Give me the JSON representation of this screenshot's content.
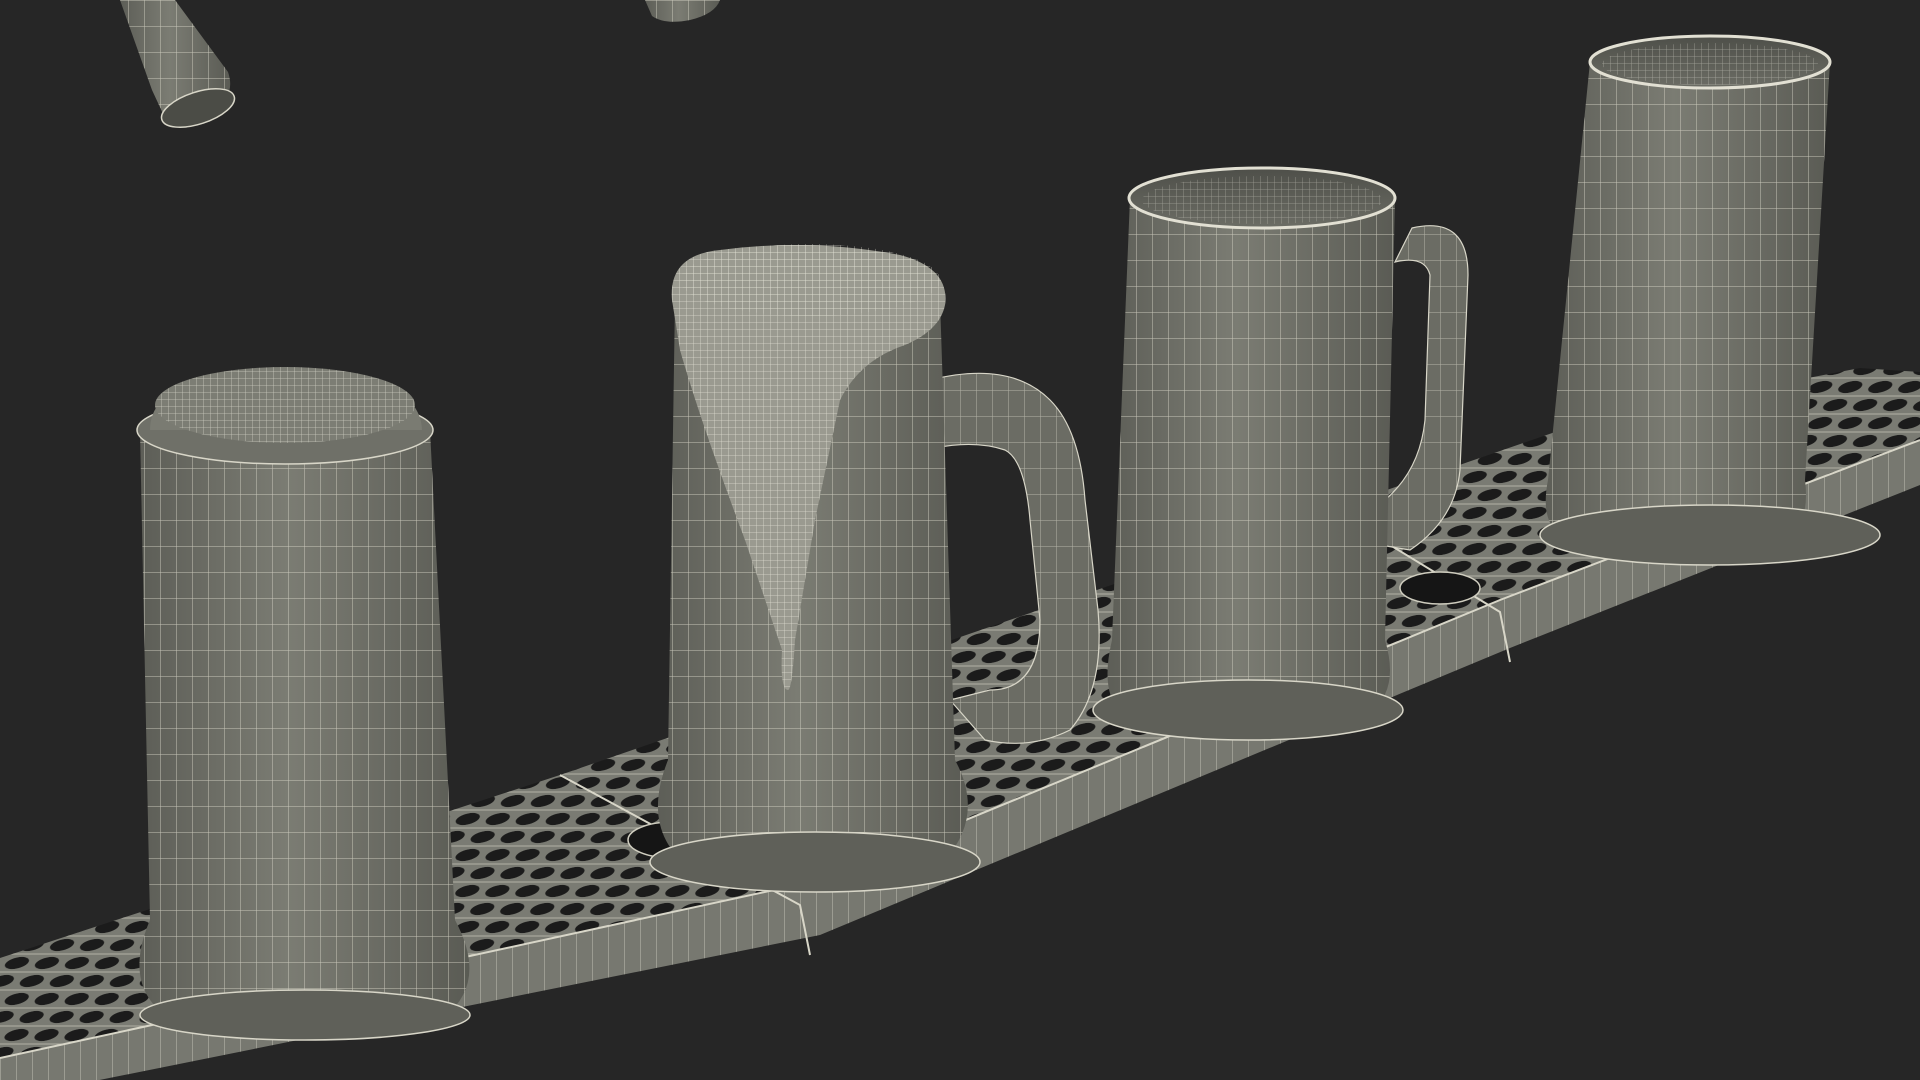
{
  "scene": {
    "background": "#262626",
    "mesh_fill": "#6f7068",
    "mesh_fill_dark": "#55564f",
    "mesh_fill_light": "#86877e",
    "wire_color": "#d8d6c8",
    "hole_color": "#1b1b1b",
    "objects": [
      {
        "name": "beer-tap-nozzle-left",
        "kind": "tap"
      },
      {
        "name": "beer-tap-nozzle-right",
        "kind": "tap"
      },
      {
        "name": "drip-tray",
        "kind": "tray",
        "segments": 3
      },
      {
        "name": "mug-lidded",
        "kind": "mug",
        "state": "lidded"
      },
      {
        "name": "mug-foaming",
        "kind": "mug",
        "state": "overflowing foam"
      },
      {
        "name": "mug-empty",
        "kind": "mug",
        "state": "empty"
      },
      {
        "name": "glass-tall",
        "kind": "glass",
        "state": "empty"
      }
    ]
  }
}
